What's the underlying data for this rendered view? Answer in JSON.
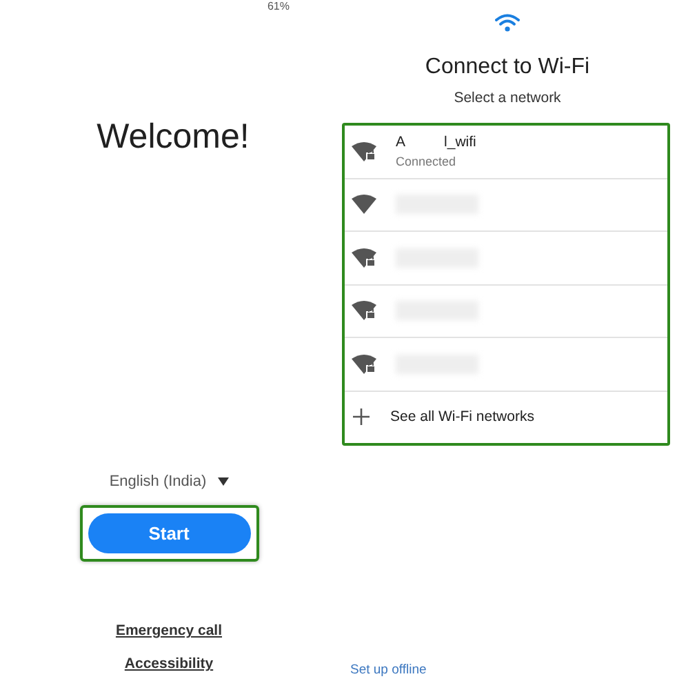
{
  "status_bar": {
    "battery": "61%"
  },
  "welcome": {
    "title": "Welcome!",
    "language": "English (India)",
    "start_button": {
      "label": "Start",
      "highlighted": true
    },
    "links": [
      "Emergency call",
      "Accessibility"
    ]
  },
  "wifi_setup": {
    "title": "Connect to Wi-Fi",
    "subtitle": "Select a network",
    "list_highlighted": true,
    "networks": [
      {
        "kind": "named",
        "name": "A",
        "name_end": "l_wifi",
        "status": "Connected",
        "locked": true
      },
      {
        "kind": "redacted",
        "locked": false
      },
      {
        "kind": "redacted",
        "locked": true
      },
      {
        "kind": "redacted",
        "locked": true
      },
      {
        "kind": "redacted",
        "locked": true
      }
    ],
    "see_all": "See all Wi-Fi networks",
    "offline_link": "Set up offline"
  }
}
